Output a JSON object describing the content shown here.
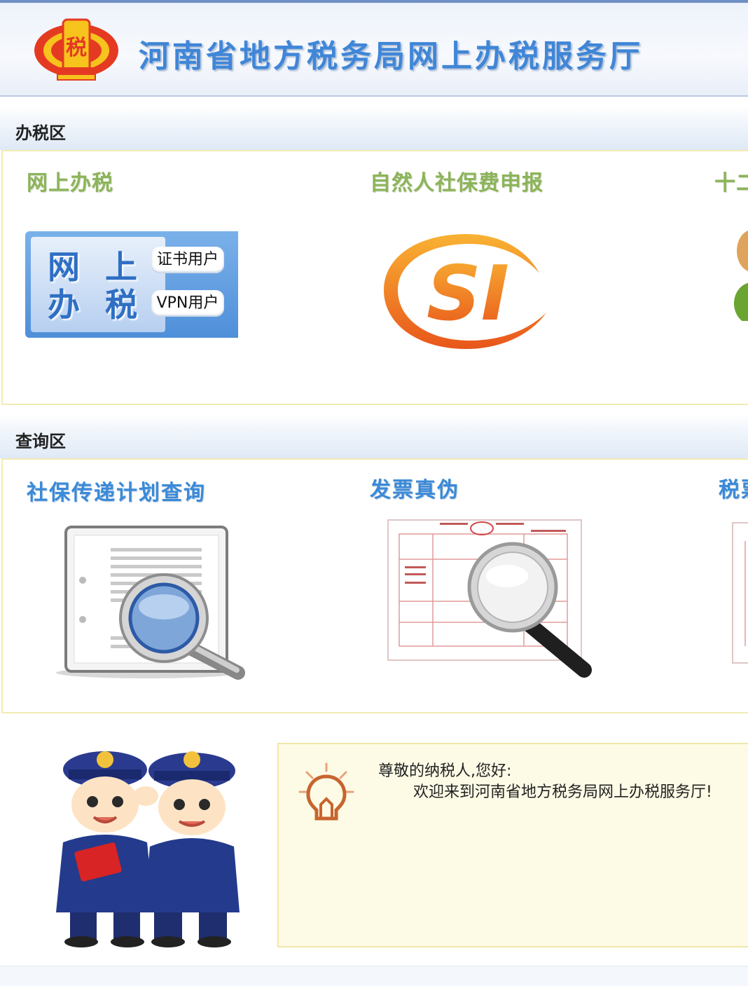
{
  "header": {
    "title": "河南省地方税务局网上办税服务厅",
    "emblem_glyph": "税"
  },
  "section_tax": {
    "label": "办税区",
    "items": [
      {
        "title": "网上办税",
        "button_big_line1": "网 上",
        "button_big_line2": "办 税",
        "pill_cert": "证书用户",
        "pill_vpn": "VPN用户"
      },
      {
        "title": "自然人社保费申报",
        "logo_text": "SI"
      },
      {
        "title": "十二"
      }
    ]
  },
  "section_query": {
    "label": "查询区",
    "items": [
      {
        "title": "社保传递计划查询"
      },
      {
        "title": "发票真伪"
      },
      {
        "title": "税票"
      }
    ]
  },
  "welcome": {
    "greeting": "尊敬的纳税人,您好:",
    "message": "欢迎来到河南省地方税务局网上办税服务厅!"
  },
  "colors": {
    "accent_blue": "#3a8ad8",
    "accent_green": "#8cb45a",
    "panel_border": "#f2ecb2",
    "welcome_bg": "#fdfbe6"
  },
  "icons": [
    "tax-emblem-icon",
    "si-logo-icon",
    "person-icon",
    "document-search-icon",
    "invoice-search-icon",
    "lightbulb-icon",
    "tax-officers-illustration"
  ]
}
